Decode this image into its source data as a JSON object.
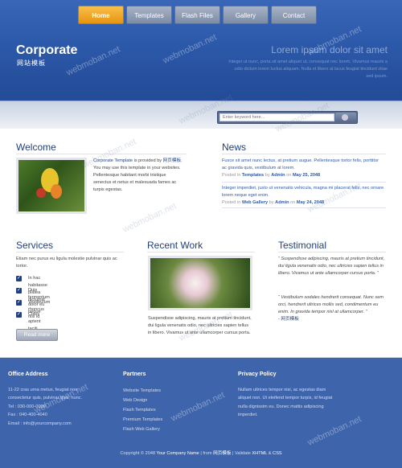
{
  "nav": {
    "items": [
      "Home",
      "Templates",
      "Flash Files",
      "Gallery",
      "Contact"
    ]
  },
  "header": {
    "logo": "Corporate",
    "logo_sub": "网站模板",
    "tagline": "Lorem ipsum dolor sit amet",
    "tagline_text": "Integer ut nunc, porta sit amet aliquet ut, consequat nec lorem. Vivamus mauris a odio dictum lorem luctus aliquam. Nulla et libero at lacus feugiat tincidunt vitae sed ipsum."
  },
  "search": {
    "placeholder": "Enter keyword here..."
  },
  "welcome": {
    "title": "Welcome",
    "link_text": "Corporate Template",
    "text1": " is provided by ",
    "provider": "网页模板",
    "text2": ". You may use this template in your websites. Pellentesque habitant morbi tristique senectus et netus et malesuada fames ac turpis egestas."
  },
  "news": {
    "title": "News",
    "items": [
      {
        "text": "Fusce sit amet nunc lectus, at pretium augue. Pellentesque tortor felis, porttitor ac gravida quis, vestibulum at lorem.",
        "posted": "Posted in ",
        "cat": "Templates",
        "by": " by ",
        "author": "Admin",
        "on": " on ",
        "date": "May 25, 2048"
      },
      {
        "text": "Integer imperdiet, justo ut venenatis vehicula, magna mi placerat felis, nec ornare lorem neque eget enim.",
        "posted": "Posted in ",
        "cat": "Web Gallery",
        "by": " by ",
        "author": "Admin",
        "on": " on ",
        "date": "May 24, 2048"
      }
    ]
  },
  "services": {
    "title": "Services",
    "intro": "Etiam nec purus eu ligula molestie pulvinar quis ac tortor.",
    "items": [
      "In hac habitasse platea dictumst",
      "Duis fermentum dolor eu neque",
      "Vestibulum rhoncus nisl id",
      "Class aptent taciti sociosqu"
    ],
    "read_more": "Read more"
  },
  "recent": {
    "title": "Recent Work",
    "text": "Suspendisse adipiscing, mauris at pretium tincidunt, dui ligula venenatis odio, nec ultricies sapien tellus in libero. Vivamus ut ante ullamcorper cursus porta."
  },
  "testimonial": {
    "title": "Testimonial",
    "quotes": [
      {
        "text": "“ Suspendisse adipiscing, mauris at pretium tincidunt, dui ligula venenatis odio, nec ultricies sapien tellus in libero. Vivamus ut ante ullamcorper cursus porta. ”"
      },
      {
        "text": "“ Vestibulum sodales hendrerit consequat. Nunc sem orci, hendrerit ultrices mollis sed, condimentum eu enim. In gravida tempor nisl at ullamcorper. ”",
        "author": "- 网页模板"
      }
    ]
  },
  "footer": {
    "office_title": "Office Address",
    "office_lines": [
      "11-22 cras urna metus, feugiat non,",
      "consectetur quis, pulvinar quis, nunc.",
      "Tel : 030-000-0000",
      "Fax : 040-400-4040",
      "Email : info@yourcompany.com"
    ],
    "partners_title": "Partners",
    "partners": [
      "Website Templates",
      "Web Design",
      "Flash Templates",
      "Premium Templates",
      "Flash Web Gallery"
    ],
    "privacy_title": "Privacy Policy",
    "privacy_text": "Nullam ultrices tempor nisi, ac egestas diam aliquet non. Ut eleifend tempor turpis, id feugiat nulla dignissim eu. Donec mattis adipiscing imperdiet.",
    "copyright_pre": "Copyright © 2048 ",
    "company": "Your Company Name",
    "copyright_mid": " | from ",
    "from": "网页模板",
    "copyright_sep": " | Validate ",
    "xhtml": "XHTML",
    "amp": " & ",
    "css": "CSS"
  },
  "watermark": "webmoban.net"
}
